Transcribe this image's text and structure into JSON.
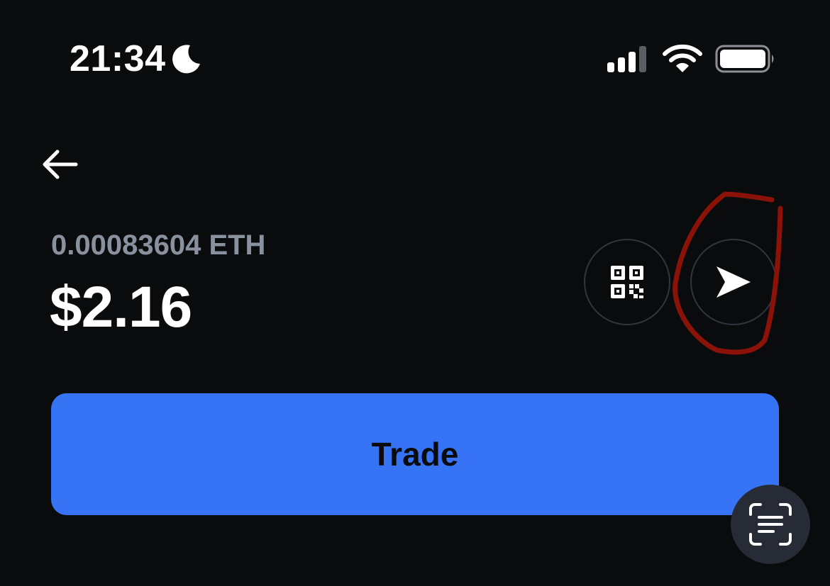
{
  "status_bar": {
    "time": "21:34",
    "icons": [
      "moon-icon",
      "cellular-signal-icon",
      "wifi-icon",
      "battery-icon"
    ]
  },
  "nav": {
    "back_icon": "arrow-left-icon"
  },
  "balance": {
    "crypto_amount": "0.00083604 ETH",
    "fiat_amount": "$2.16"
  },
  "actions": {
    "receive_icon": "qr-code-icon",
    "send_icon": "paper-plane-icon"
  },
  "trade_button": {
    "label": "Trade"
  },
  "scan_button": {
    "icon": "text-scan-icon"
  },
  "colors": {
    "background": "#0a0b0d",
    "primary_blue": "#3773f5",
    "muted_text": "#8a919e",
    "annotation_red": "#8a1208",
    "fab_background": "#262b36"
  }
}
